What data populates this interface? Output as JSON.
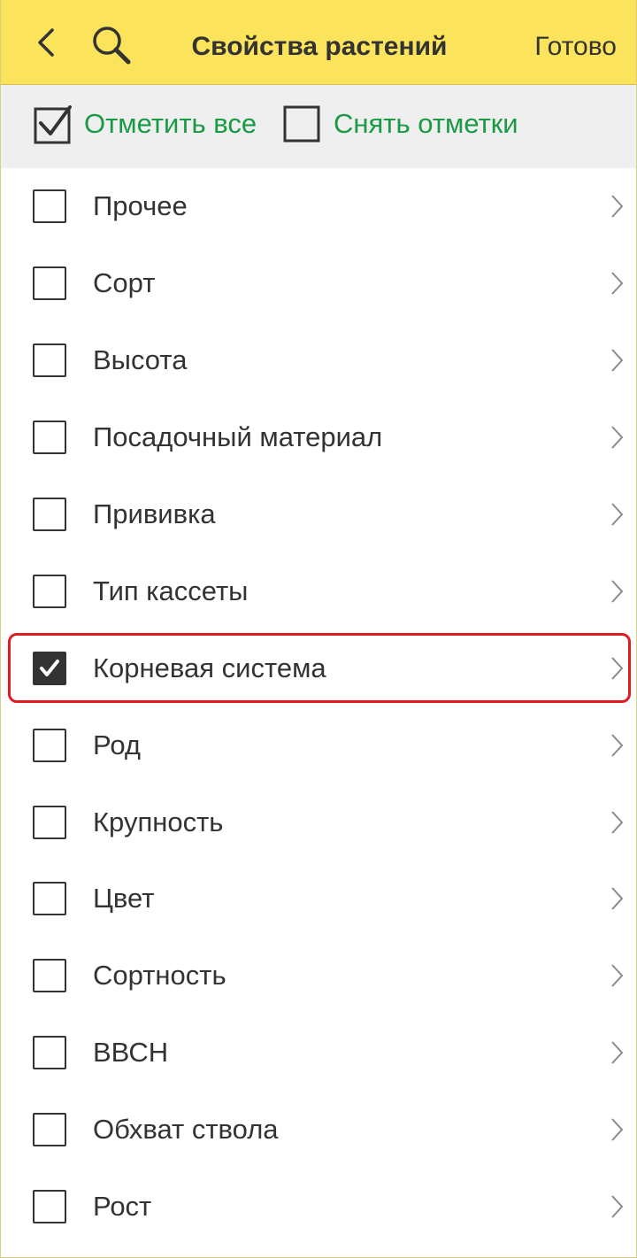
{
  "header": {
    "back_icon": "chevron-left-icon",
    "search_icon": "search-icon",
    "title": "Свойства растений",
    "done_label": "Готово",
    "background": "#fbe35c"
  },
  "toolbar": {
    "check_all_label": "Отметить все",
    "uncheck_all_label": "Снять отметки",
    "accent": "#1a9a45"
  },
  "list": {
    "items": [
      {
        "label": "Прочее",
        "checked": false
      },
      {
        "label": "Сорт",
        "checked": false
      },
      {
        "label": "Высота",
        "checked": false
      },
      {
        "label": "Посадочный материал",
        "checked": false
      },
      {
        "label": "Прививка",
        "checked": false
      },
      {
        "label": "Тип кассеты",
        "checked": false
      },
      {
        "label": "Корневая система",
        "checked": true,
        "highlighted": true
      },
      {
        "label": "Род",
        "checked": false
      },
      {
        "label": "Крупность",
        "checked": false
      },
      {
        "label": "Цвет",
        "checked": false
      },
      {
        "label": "Сортность",
        "checked": false
      },
      {
        "label": "ВВСН",
        "checked": false
      },
      {
        "label": "Обхват ствола",
        "checked": false
      },
      {
        "label": "Рост",
        "checked": false
      }
    ],
    "highlight_color": "#e01b22"
  }
}
